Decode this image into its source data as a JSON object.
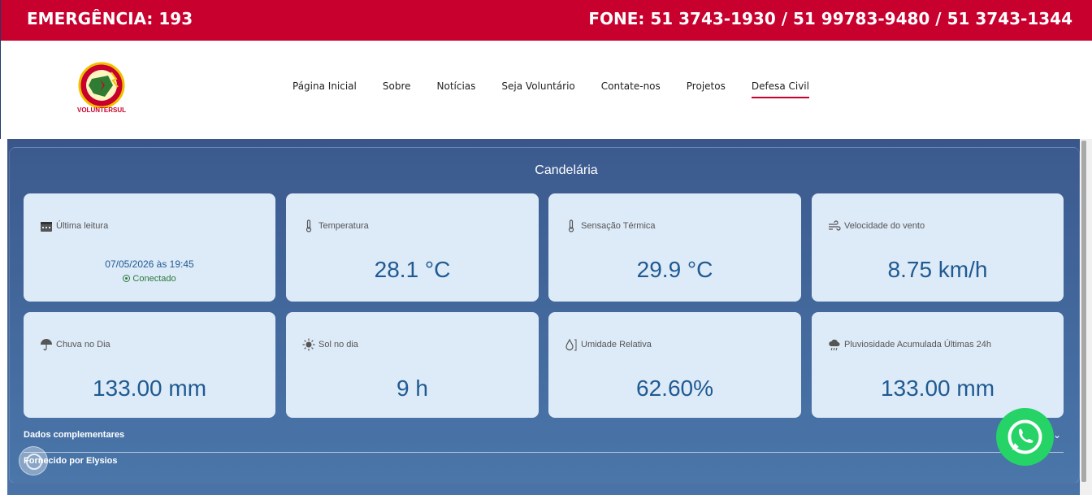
{
  "topbar": {
    "emergency": "EMERGÊNCIA: 193",
    "phones": "FONE: 51 3743-1930 / 51 99783-9480 / 51 3743-1344"
  },
  "logo": {
    "text": "VOLUNTERSUL"
  },
  "nav": {
    "items": [
      {
        "label": "Página Inicial"
      },
      {
        "label": "Sobre"
      },
      {
        "label": "Notícias"
      },
      {
        "label": "Seja Voluntário"
      },
      {
        "label": "Contate-nos"
      },
      {
        "label": "Projetos"
      },
      {
        "label": "Defesa Civil",
        "active": true
      }
    ]
  },
  "weather": {
    "city": "Candelária",
    "cards": [
      {
        "label": "Última leitura",
        "icon": "calendar-icon",
        "date": "07/05/2026 às 19:45",
        "status": "Conectado"
      },
      {
        "label": "Temperatura",
        "icon": "thermometer-icon",
        "value": "28.1 °C"
      },
      {
        "label": "Sensação Térmica",
        "icon": "thermometer-icon",
        "value": "29.9 °C"
      },
      {
        "label": "Velocidade do vento",
        "icon": "wind-icon",
        "value": "8.75 km/h"
      },
      {
        "label": "Chuva no Dia",
        "icon": "umbrella-icon",
        "value": "133.00 mm"
      },
      {
        "label": "Sol no dia",
        "icon": "sun-icon",
        "value": "9 h"
      },
      {
        "label": "Umidade Relativa",
        "icon": "humidity-icon",
        "value": "62.60%"
      },
      {
        "label": "Pluviosidade Acumulada Últimas 24h",
        "icon": "rain-cloud-icon",
        "value": "133.00 mm"
      }
    ],
    "extra_label": "Dados complementares",
    "powered": "Fornecido por Elysios"
  },
  "colors": {
    "brand_red": "#c8002e",
    "panel_blue": "#3c5a8e",
    "card_bg": "#ddeaf8",
    "value_blue": "#1f5a91",
    "whatsapp_green": "#25d366"
  }
}
